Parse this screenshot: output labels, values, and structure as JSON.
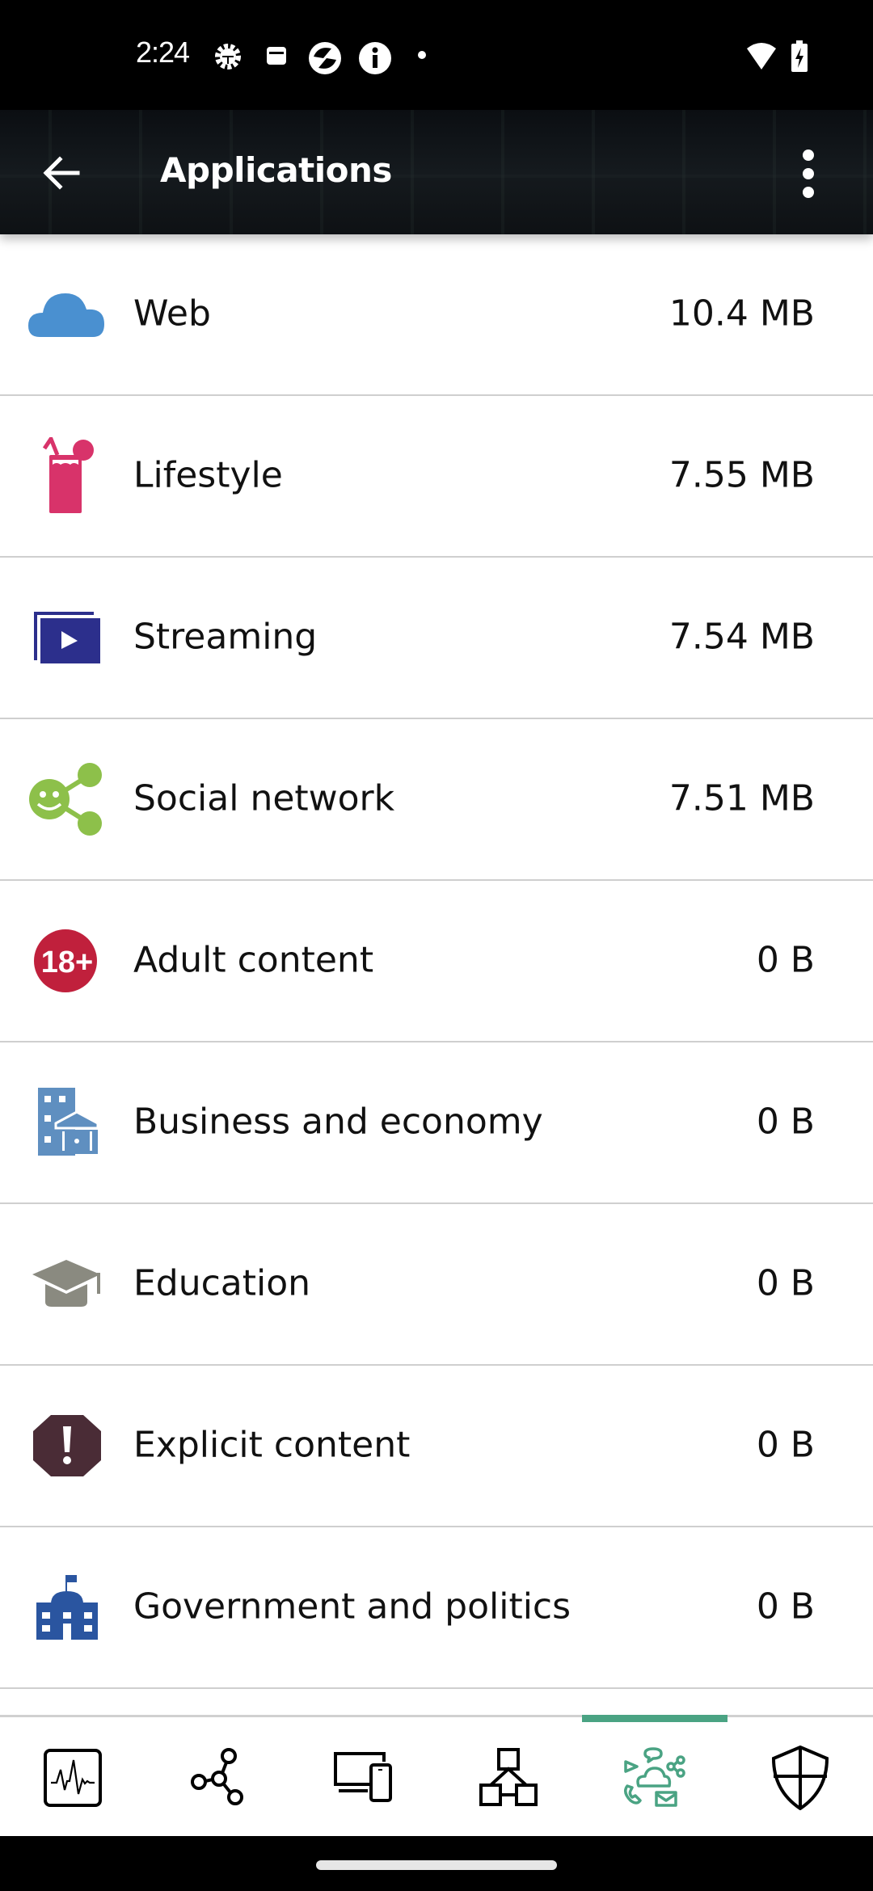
{
  "status_bar": {
    "time": "2:24",
    "left_icons": [
      "settings-gear-icon",
      "wallet-icon",
      "app-notification-icon",
      "info-icon",
      "dot-icon"
    ],
    "right_icons": [
      "wifi-icon",
      "battery-charging-icon"
    ]
  },
  "app_bar": {
    "title": "Applications",
    "back_icon": "arrow-back-icon",
    "menu_icon": "more-vert-icon"
  },
  "colors": {
    "accent": "#4aa383",
    "divider": "#cfcfcf"
  },
  "categories": [
    {
      "label": "Web",
      "value": "10.4 MB",
      "icon": "cloud-icon",
      "color": "#4a90d0"
    },
    {
      "label": "Lifestyle",
      "value": "7.55 MB",
      "icon": "drink-icon",
      "color": "#d8336a"
    },
    {
      "label": "Streaming",
      "value": "7.54 MB",
      "icon": "video-play-icon",
      "color": "#2c2f8c"
    },
    {
      "label": "Social network",
      "value": "7.51 MB",
      "icon": "social-share-icon",
      "color": "#8dc04a"
    },
    {
      "label": "Adult content",
      "value": "0 B",
      "icon": "adult-18-plus-icon",
      "color": "#c0203c",
      "badge_text": "18+"
    },
    {
      "label": "Business and economy",
      "value": "0 B",
      "icon": "business-building-icon",
      "color": "#5f8fc0"
    },
    {
      "label": "Education",
      "value": "0 B",
      "icon": "graduation-cap-icon",
      "color": "#8a8a80"
    },
    {
      "label": "Explicit content",
      "value": "0 B",
      "icon": "explicit-warning-icon",
      "color": "#4a2c36"
    },
    {
      "label": "Government and politics",
      "value": "0 B",
      "icon": "government-building-icon",
      "color": "#2a55a0"
    }
  ],
  "bottom_nav": [
    {
      "name": "activity",
      "icon": "activity-monitor-icon",
      "active": false
    },
    {
      "name": "network",
      "icon": "network-nodes-icon",
      "active": false
    },
    {
      "name": "devices",
      "icon": "devices-icon",
      "active": false
    },
    {
      "name": "topology",
      "icon": "topology-icon",
      "active": false
    },
    {
      "name": "applications",
      "icon": "applications-icon",
      "active": true
    },
    {
      "name": "security",
      "icon": "shield-icon",
      "active": false
    }
  ]
}
